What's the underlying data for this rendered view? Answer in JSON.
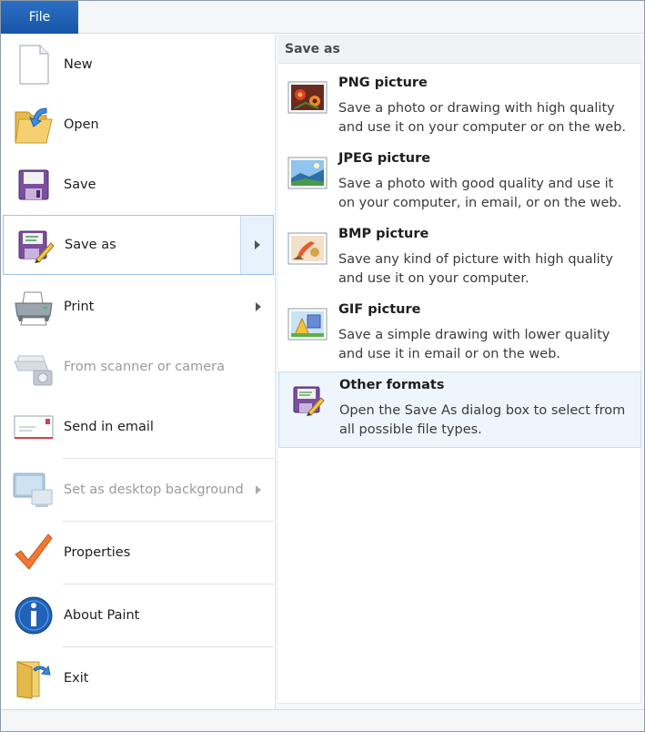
{
  "file_tab": {
    "label": "File"
  },
  "menu": {
    "new": {
      "label": "New"
    },
    "open": {
      "label": "Open"
    },
    "save": {
      "label": "Save"
    },
    "save_as": {
      "label": "Save as"
    },
    "print": {
      "label": "Print"
    },
    "scanner": {
      "label": "From scanner or camera"
    },
    "email": {
      "label": "Send in email"
    },
    "desktop_bg": {
      "label": "Set as desktop background"
    },
    "properties": {
      "label": "Properties"
    },
    "about": {
      "label": "About Paint"
    },
    "exit": {
      "label": "Exit"
    }
  },
  "save_as_panel": {
    "header": "Save as",
    "formats": [
      {
        "title": "PNG picture",
        "description": "Save a photo or drawing with high quality and use it on your computer or on the web.",
        "icon": "png-picture-icon"
      },
      {
        "title": "JPEG picture",
        "description": "Save a photo with good quality and use it on your computer, in email, or on the web.",
        "icon": "jpeg-picture-icon"
      },
      {
        "title": "BMP picture",
        "description": "Save any kind of picture with high quality and use it on your computer.",
        "icon": "bmp-picture-icon"
      },
      {
        "title": "GIF picture",
        "description": "Save a simple drawing with lower quality and use it in email or on the web.",
        "icon": "gif-picture-icon"
      },
      {
        "title": "Other formats",
        "description": "Open the Save As dialog box to select from all possible file types.",
        "icon": "save-as-icon"
      }
    ]
  },
  "colors": {
    "file_tab": "#1a5fb4",
    "selection_border": "#9cc4e8",
    "hover_fill": "#eef5fc"
  }
}
